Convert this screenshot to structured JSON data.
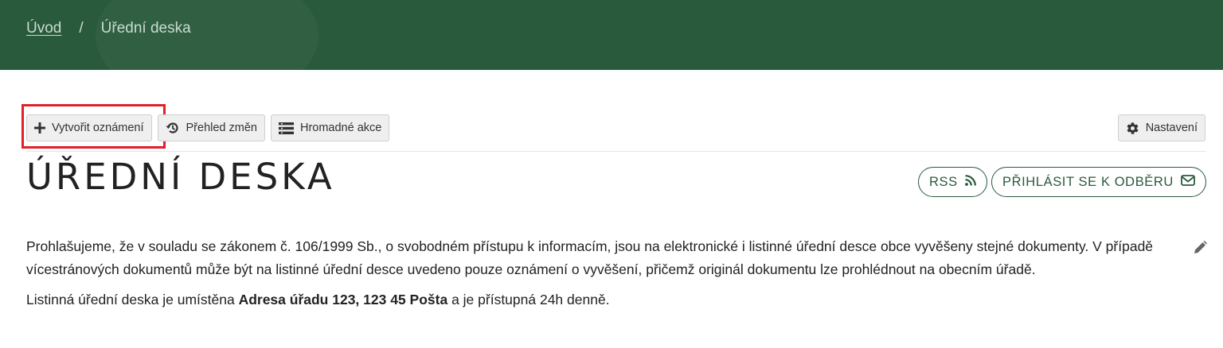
{
  "breadcrumb": {
    "home": "Úvod",
    "separator": "/",
    "current": "Úřední deska"
  },
  "toolbar": {
    "create": "Vytvořit oznámení",
    "changes": "Přehled změn",
    "bulk": "Hromadné akce",
    "settings": "Nastavení"
  },
  "page": {
    "title": "ÚŘEDNÍ DESKA",
    "rss": "RSS",
    "subscribe": "PŘIHLÁSIT SE K ODBĚRU"
  },
  "content": {
    "paragraph1": "Prohlašujeme, že v souladu se zákonem č. 106/1999 Sb., o svobodném přístupu k informacím, jsou na elektronické i listinné úřední desce obce vyvěšeny stejné dokumenty. V případě vícestránových dokumentů může být na listinné úřední desce uvedeno pouze oznámení o vyvěšení, přičemž originál dokumentu lze prohlédnout na obecním úřadě.",
    "p2_before": "Listinná úřední deska je umístěna ",
    "p2_bold": "Adresa úřadu 123, 123 45 Pošta",
    "p2_after": " a je přístupná 24h denně."
  },
  "colors": {
    "brand_green": "#2a5a3c",
    "highlight_red": "#e0202a"
  },
  "icons": [
    "plus-icon",
    "history-icon",
    "list-icon",
    "gear-icon",
    "rss-icon",
    "envelope-icon",
    "pencil-icon"
  ]
}
